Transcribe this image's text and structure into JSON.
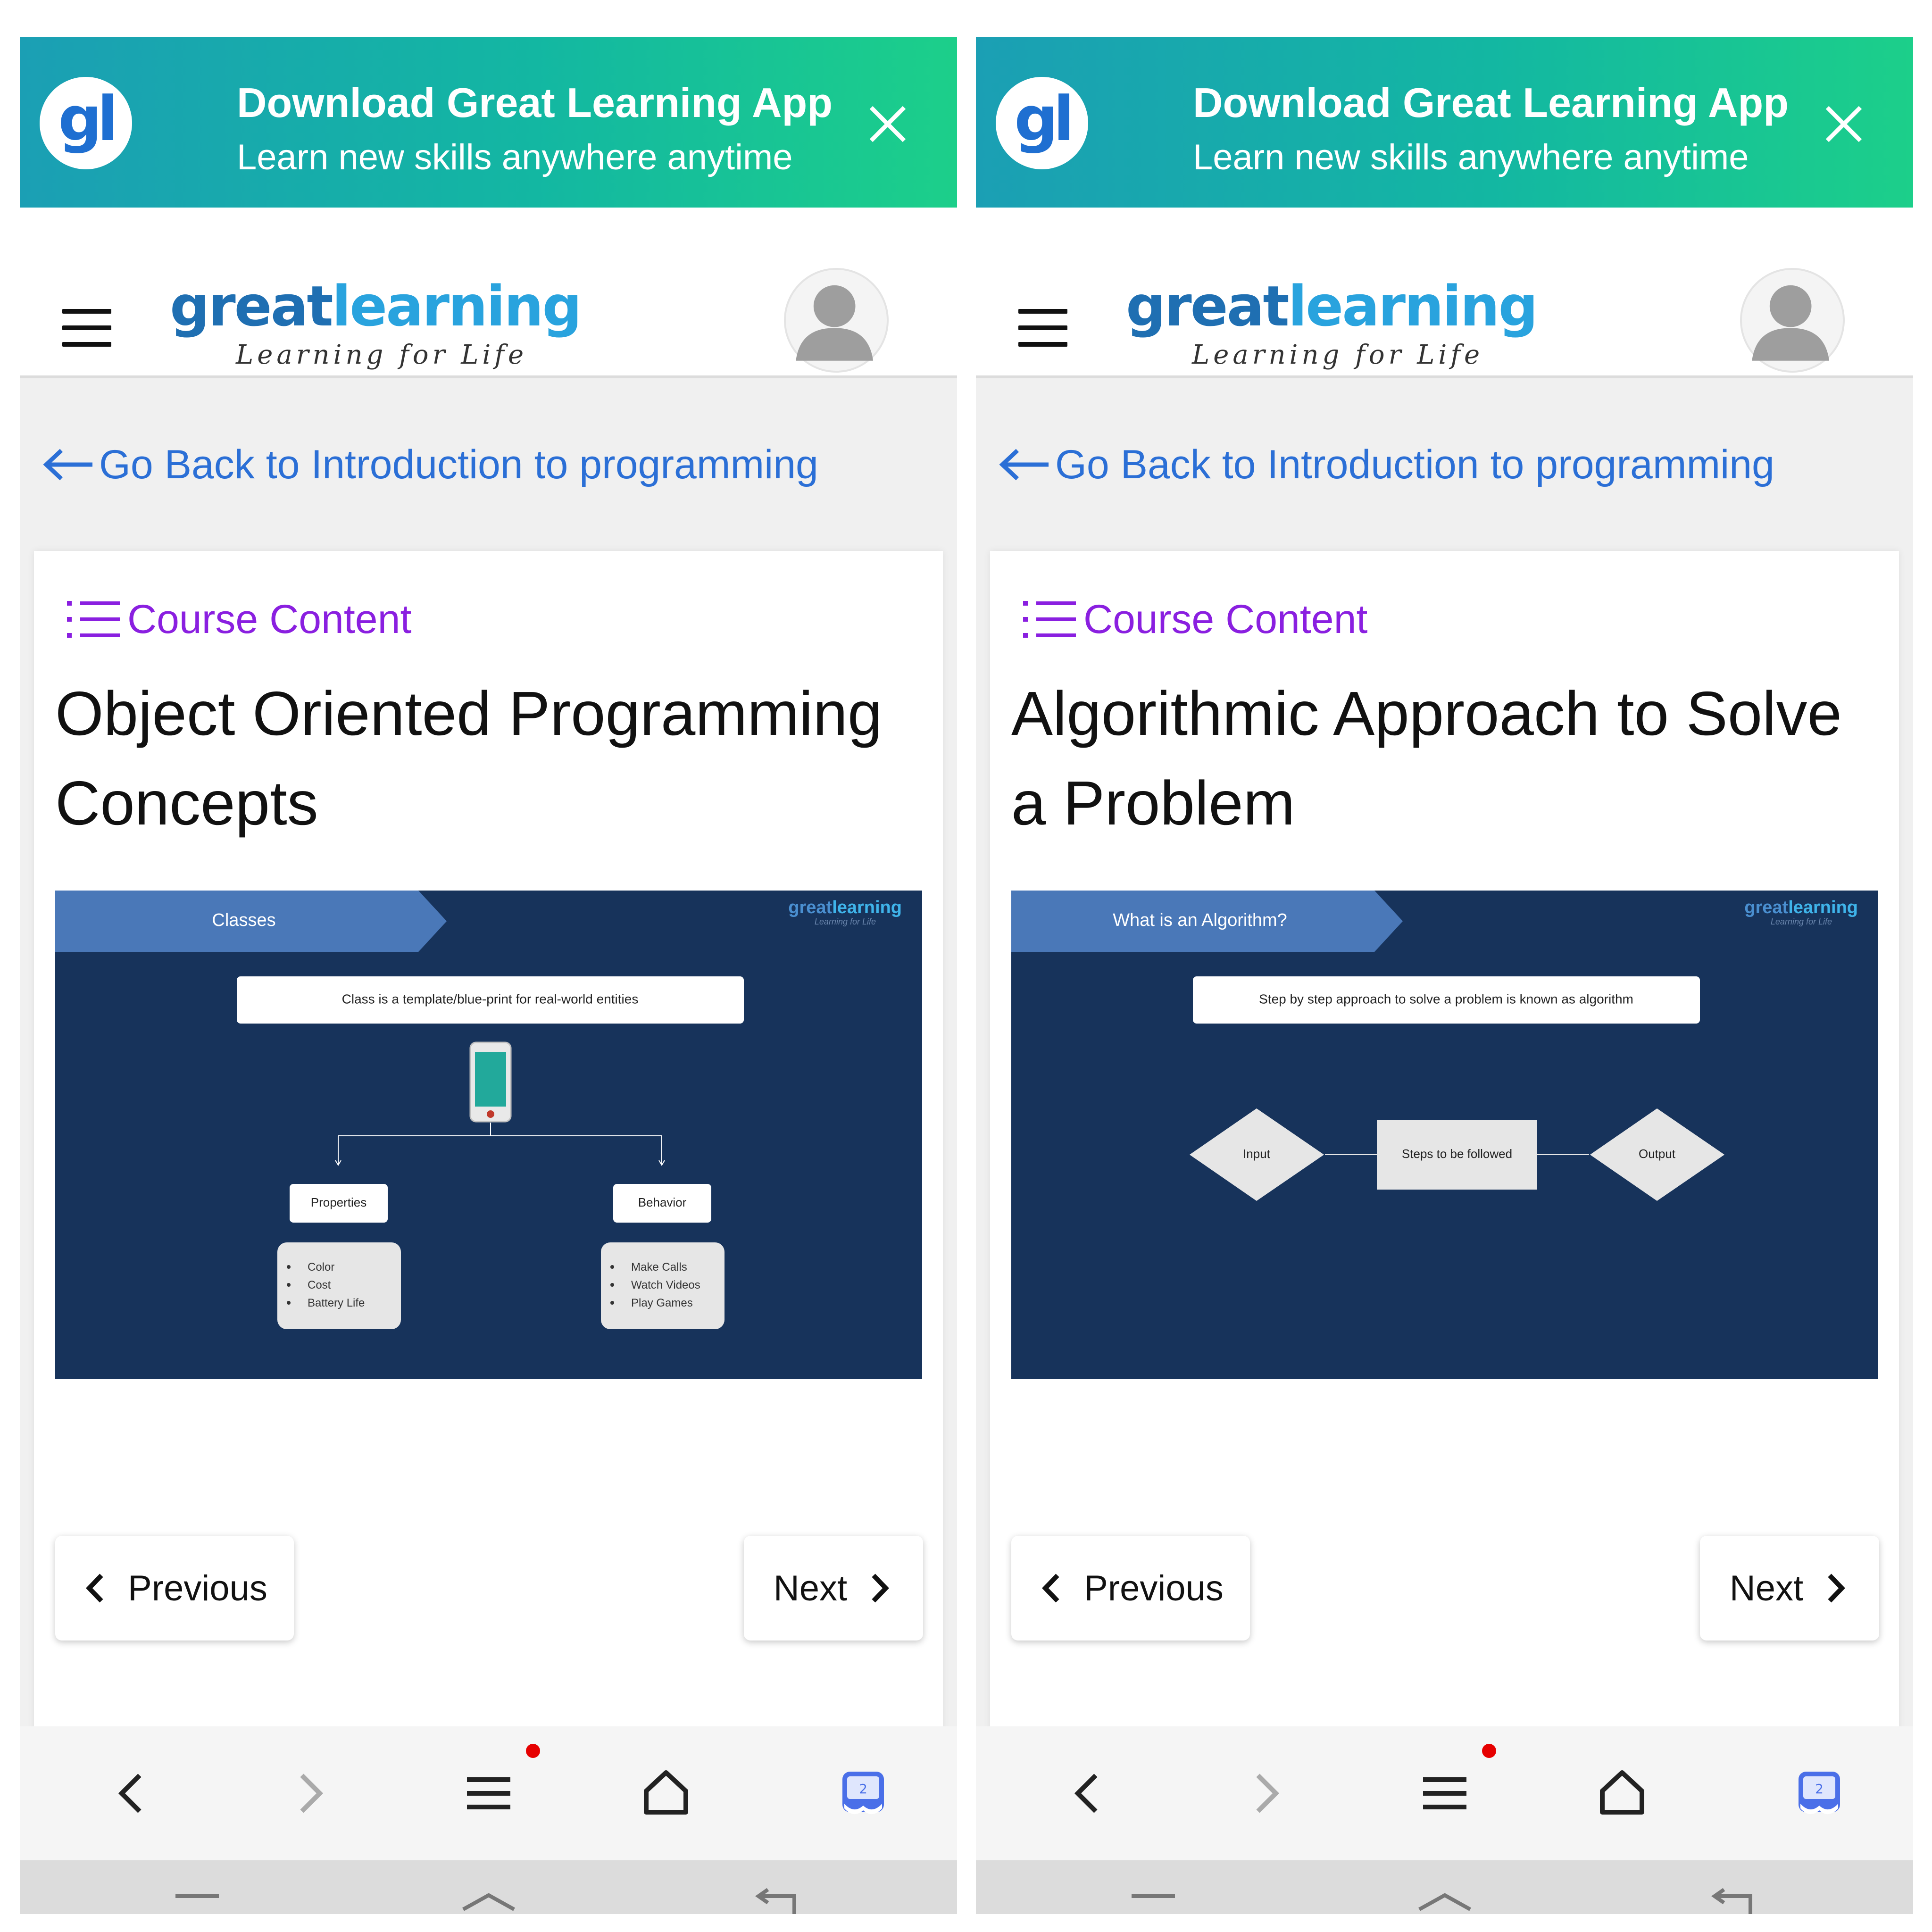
{
  "screens": [
    {
      "banner": {
        "logo_text": "gl",
        "title": "Download Great Learning App",
        "subtitle": "Learn new skills anywhere anytime"
      },
      "header": {
        "logo_part1": "great",
        "logo_part2": "learning",
        "tagline": "Learning for Life"
      },
      "back_link": "Go Back to Introduction to programming",
      "course_content_label": "Course Content",
      "lesson_title": "Object Oriented Programming Concepts",
      "slide": {
        "header": "Classes",
        "brand_part1": "great",
        "brand_part2": "learning",
        "brand_tagline": "Learning for Life",
        "definition": "Class is a template/blue-print for real-world entities",
        "left_box": "Properties",
        "left_items": [
          "Color",
          "Cost",
          "Battery Life"
        ],
        "right_box": "Behavior",
        "right_items": [
          "Make Calls",
          "Watch Videos",
          "Play Games"
        ]
      },
      "prev_label": "Previous",
      "next_label": "Next",
      "tab_count": "2"
    },
    {
      "banner": {
        "logo_text": "gl",
        "title": "Download Great Learning App",
        "subtitle": "Learn new skills anywhere anytime"
      },
      "header": {
        "logo_part1": "great",
        "logo_part2": "learning",
        "tagline": "Learning for Life"
      },
      "back_link": "Go Back to Introduction to programming",
      "course_content_label": "Course Content",
      "lesson_title": "Algorithmic Approach to Solve a Problem",
      "slide": {
        "header": "What is an Algorithm?",
        "brand_part1": "great",
        "brand_part2": "learning",
        "brand_tagline": "Learning for Life",
        "definition": "Step by step approach to solve a problem is known as algorithm",
        "flow_input": "Input",
        "flow_steps": "Steps to be followed",
        "flow_output": "Output"
      },
      "prev_label": "Previous",
      "next_label": "Next",
      "tab_count": "2"
    }
  ],
  "colors": {
    "banner_start": "#1b9fb4",
    "banner_end": "#1ccf8a",
    "link_blue": "#2b6fd6",
    "course_purple": "#8a1fe0",
    "slide_bg": "#17335b",
    "slide_tab": "#4a78b8",
    "brand_dark": "#1f6fb2",
    "brand_light": "#29a3de",
    "notification_dot": "#e60000"
  }
}
